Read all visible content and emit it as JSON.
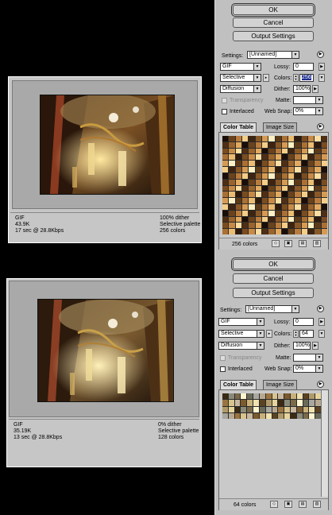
{
  "preview_top": {
    "format": "GIF",
    "file_size": "43.9K",
    "download_time": "17 sec @ 28.8Kbps",
    "dither": "100% dither",
    "palette": "Selective palette",
    "colors": "256 colors"
  },
  "preview_bottom": {
    "format": "GIF",
    "file_size": "35.19K",
    "download_time": "13 sec @ 28.8Kbps",
    "dither": "0% dither",
    "palette": "Selective palette",
    "colors": "128 colors"
  },
  "panel_top": {
    "ok_label": "OK",
    "cancel_label": "Cancel",
    "output_settings_label": "Output Settings",
    "settings_label": "Settings:",
    "settings_value": "[Unnamed]",
    "format_value": "GIF",
    "lossy_label": "Lossy:",
    "lossy_value": "0",
    "reduction_value": "Selective",
    "colors_label": "Colors:",
    "colors_value": "256",
    "dither_algo_value": "Diffusion",
    "dither_label": "Dither:",
    "dither_value": "100%",
    "transparency_label": "Transparency",
    "matte_label": "Matte:",
    "interlaced_label": "Interlaced",
    "websnap_label": "Web Snap:",
    "websnap_value": "0%",
    "tab_color_table": "Color Table",
    "tab_image_size": "Image Size",
    "color_count": "256 colors"
  },
  "panel_bottom": {
    "ok_label": "OK",
    "cancel_label": "Cancel",
    "output_settings_label": "Output Settings",
    "settings_label": "Settings:",
    "settings_value": "[Unnamed]",
    "format_value": "GIF",
    "lossy_label": "Lossy:",
    "lossy_value": "0",
    "reduction_value": "Selective",
    "colors_label": "Colors:",
    "colors_value": "64",
    "dither_algo_value": "Diffusion",
    "dither_label": "Dither:",
    "dither_value": "100%",
    "transparency_label": "Transparency",
    "matte_label": "Matte:",
    "interlaced_label": "Interlaced",
    "websnap_label": "Web Snap:",
    "websnap_value": "0%",
    "tab_color_table": "Color Table",
    "tab_image_size": "Image Size",
    "color_count": "64 colors"
  },
  "palette_top": [
    "#1a0e08",
    "#2e1a0c",
    "#3e2410",
    "#4e2e14",
    "#5c3a18",
    "#6a421c",
    "#7a4c20",
    "#8a5826",
    "#9a642c",
    "#aa7034",
    "#ba7c3c",
    "#c88a46",
    "#d69a52",
    "#e2aa60",
    "#ecbc72",
    "#f4ce88",
    "#fadea2",
    "#fff0c4"
  ],
  "palette_bottom": [
    "#3a2a14",
    "#5a4222",
    "#7a5a2e",
    "#9a7440",
    "#6a6a5a",
    "#8a8a7a",
    "#b09a6a",
    "#c8b07a",
    "#d8c48c",
    "#a8a8a0",
    "#7a6a4a",
    "#e6d49c",
    "#f0e2b0",
    "#c8b8a0",
    "#b8a890",
    "#fff4d0"
  ],
  "icons": {
    "menu_arrow": "circle-arrow-icon",
    "trash": "trash-icon",
    "new": "new-color-icon",
    "lock": "lock-icon",
    "web": "web-shift-icon"
  }
}
